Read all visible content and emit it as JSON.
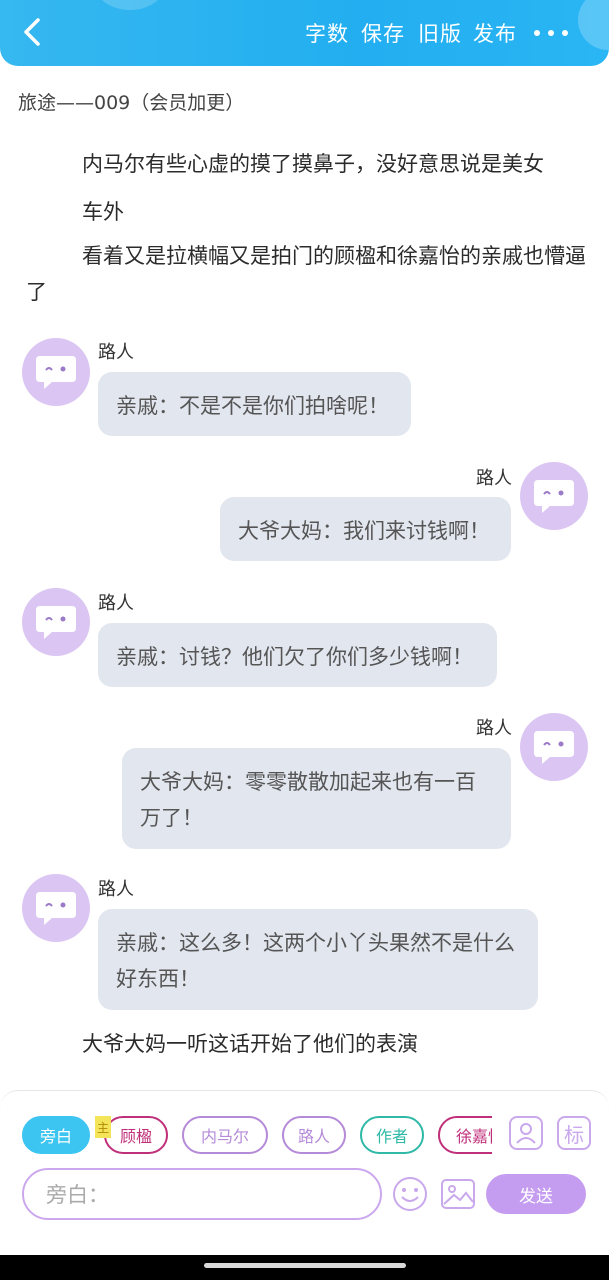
{
  "header": {
    "actions": [
      "字数",
      "保存",
      "旧版",
      "发布"
    ]
  },
  "chapter_title": "旅途——009（会员加更）",
  "narration": {
    "p1": "内马尔有些心虚的摸了摸鼻子，没好意思说是美女",
    "p2": "车外",
    "p3": "看着又是拉横幅又是拍门的顾楹和徐嘉怡的亲戚也懵逼了",
    "p4": "大爷大妈一听这话开始了他们的表演"
  },
  "messages": [
    {
      "speaker": "路人",
      "side": "left",
      "text": "亲戚：不是不是你们拍啥呢！"
    },
    {
      "speaker": "路人",
      "side": "right",
      "text": "大爷大妈：我们来讨钱啊！"
    },
    {
      "speaker": "路人",
      "side": "left",
      "text": "亲戚：讨钱？他们欠了你们多少钱啊！"
    },
    {
      "speaker": "路人",
      "side": "right",
      "text": "大爷大妈：零零散散加起来也有一百万了！"
    },
    {
      "speaker": "路人",
      "side": "left",
      "text": "亲戚：这么多！这两个小丫头果然不是什么好东西！"
    }
  ],
  "roles": [
    {
      "label": "旁白",
      "color": "#3cc5f0",
      "active": true
    },
    {
      "label": "顾楹",
      "color": "#c0307a",
      "active": false
    },
    {
      "label": "内马尔",
      "color": "#b58ad8",
      "active": false
    },
    {
      "label": "路人",
      "color": "#b58ad8",
      "active": false
    },
    {
      "label": "作者",
      "color": "#2fb9a6",
      "active": false
    },
    {
      "label": "徐嘉怡",
      "color": "#c0307a",
      "active": false
    }
  ],
  "main_tag": "主",
  "tools": {
    "role_icon": "person-card-icon",
    "mark_label": "标"
  },
  "input": {
    "placeholder": "旁白："
  },
  "send_label": "发送",
  "colors": {
    "header": "#2ab4f2",
    "avatar": "#dbc6f3",
    "bubble": "#e2e6ee",
    "send": "#c49cf0"
  }
}
